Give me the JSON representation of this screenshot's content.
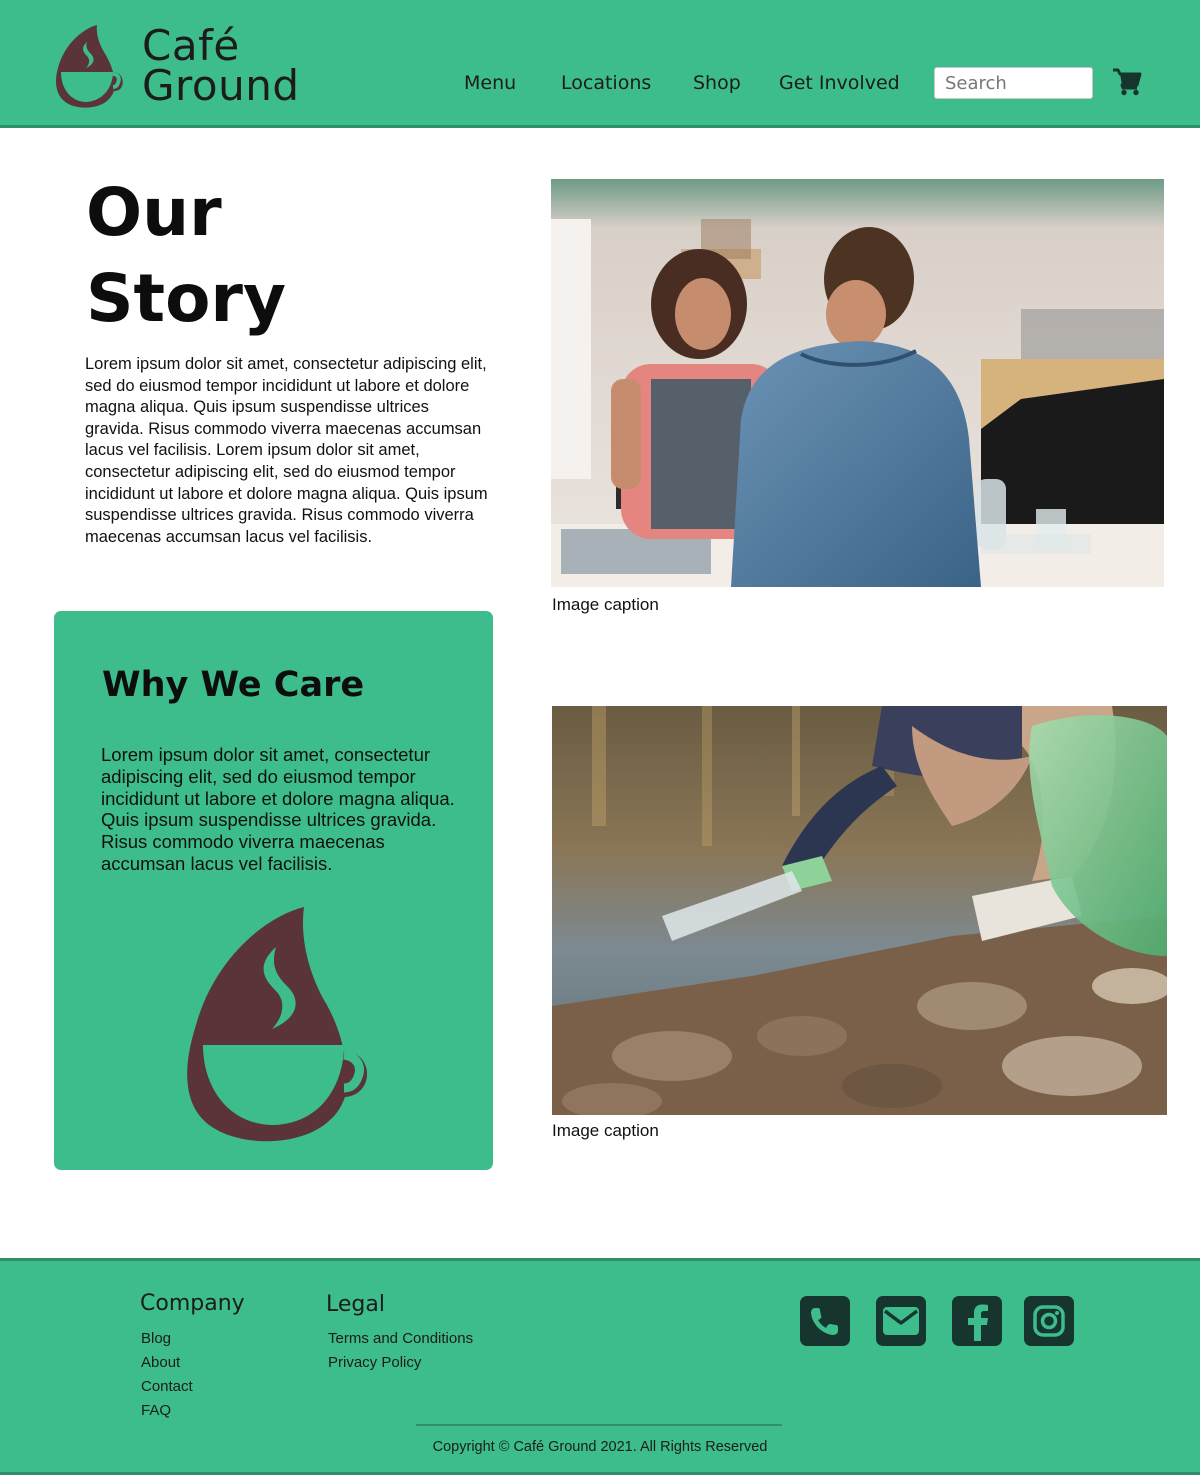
{
  "brand": {
    "line1": "Café",
    "line2": "Ground",
    "colors": {
      "primary": "#3dbd8b",
      "dark": "#16352f",
      "logo": "#5a3438"
    }
  },
  "nav": {
    "items": [
      "Menu",
      "Locations",
      "Shop",
      "Get Involved"
    ],
    "search_placeholder": "Search",
    "cart_icon": "shopping-cart-icon"
  },
  "story": {
    "title_line1": "Our",
    "title_line2": "Story",
    "body": "Lorem ipsum dolor sit amet, consectetur adipiscing elit, sed do eiusmod tempor incididunt ut labore et dolore magna aliqua. Quis ipsum suspendisse ultrices gravida. Risus commodo viverra maecenas accumsan lacus vel facilisis. Lorem ipsum dolor sit amet, consectetur adipiscing elit, sed do eiusmod tempor incididunt ut labore et dolore magna aliqua. Quis ipsum suspendisse ultrices gravida. Risus commodo viverra maecenas accumsan lacus vel facilisis."
  },
  "photos": [
    {
      "caption": "Image caption"
    },
    {
      "caption": "Image caption"
    }
  ],
  "care": {
    "title": "Why We Care",
    "body": "Lorem ipsum dolor sit amet, consectetur adipiscing elit, sed do eiusmod tempor incididunt ut labore et dolore magna aliqua. Quis ipsum suspendisse ultrices gravida. Risus commodo viverra maecenas accumsan lacus vel facilisis."
  },
  "footer": {
    "company": {
      "heading": "Company",
      "links": [
        "Blog",
        "About",
        "Contact",
        "FAQ"
      ]
    },
    "legal": {
      "heading": "Legal",
      "links": [
        "Terms and Conditions",
        "Privacy Policy"
      ]
    },
    "social_icons": [
      "phone-icon",
      "envelope-icon",
      "facebook-icon",
      "instagram-icon"
    ],
    "copyright": "Copyright © Café Ground 2021. All Rights Reserved"
  }
}
